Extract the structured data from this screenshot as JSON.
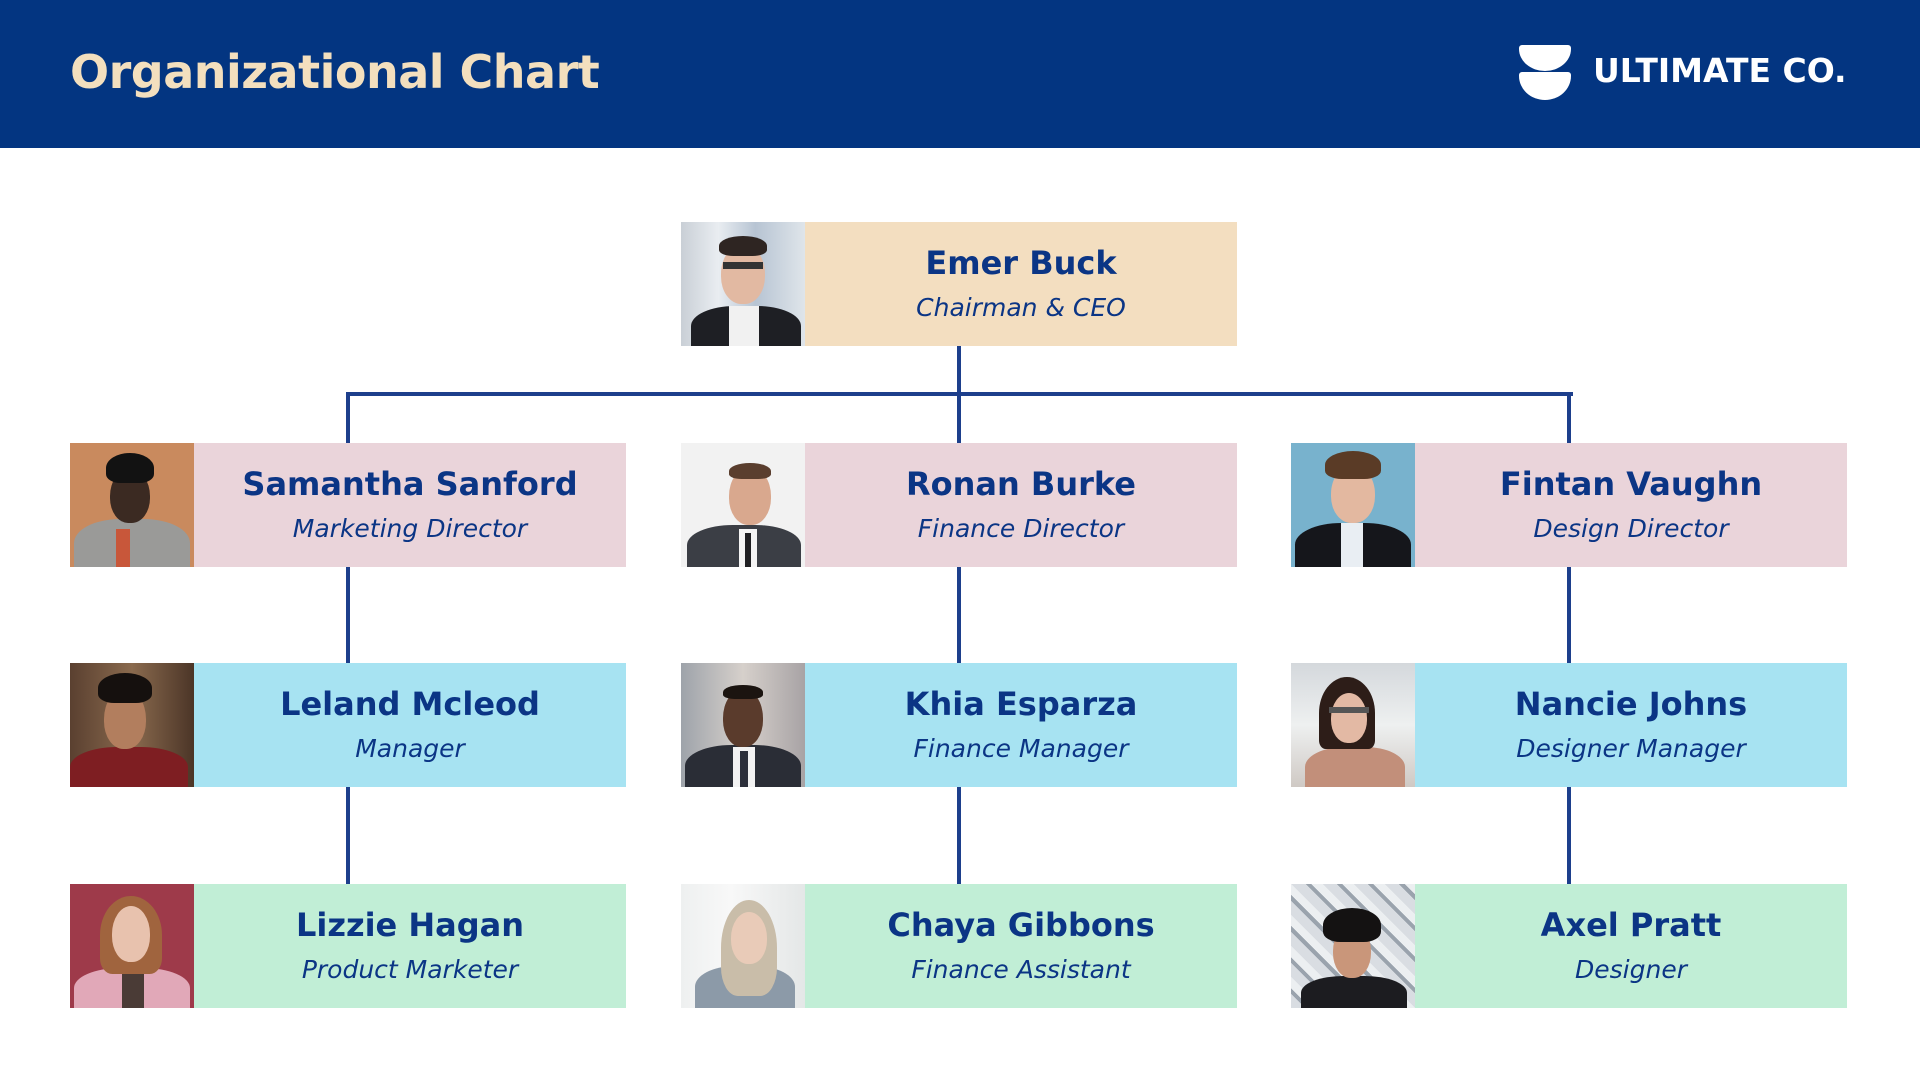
{
  "header": {
    "title": "Organizational Chart",
    "logo_icon": "stacked-bowls-logo-icon",
    "company_name": "ULTIMATE CO."
  },
  "colors": {
    "header_bg": "#033581",
    "title_text": "#F3DFBE",
    "name_text": "#0B3585",
    "connector": "#1D3F8C",
    "ceo_box": "#F3DEC0",
    "director_box": "#EAD4DA",
    "manager_box": "#A7E3F2",
    "staff_box": "#C1EED6"
  },
  "org": {
    "ceo": {
      "name": "Emer Buck",
      "role": "Chairman & CEO",
      "photo": "portrait-man-glasses-icon"
    },
    "columns": [
      {
        "director": {
          "name": "Samantha Sanford",
          "role": "Marketing Director",
          "photo": "portrait-woman-grey-blazer-icon"
        },
        "manager": {
          "name": "Leland Mcleod",
          "role": "Manager",
          "photo": "portrait-man-red-shirt-icon"
        },
        "staff": {
          "name": "Lizzie Hagan",
          "role": "Product Marketer",
          "photo": "portrait-woman-pink-blazer-icon"
        }
      },
      {
        "director": {
          "name": "Ronan Burke",
          "role": "Finance Director",
          "photo": "portrait-man-suit-smiling-icon"
        },
        "manager": {
          "name": "Khia Esparza",
          "role": "Finance Manager",
          "photo": "portrait-man-dark-suit-icon"
        },
        "staff": {
          "name": "Chaya Gibbons",
          "role": "Finance Assistant",
          "photo": "portrait-woman-blonde-icon"
        }
      },
      {
        "director": {
          "name": "Fintan Vaughn",
          "role": "Design Director",
          "photo": "portrait-man-blue-background-icon"
        },
        "manager": {
          "name": "Nancie Johns",
          "role": "Designer Manager",
          "photo": "portrait-woman-glasses-icon"
        },
        "staff": {
          "name": "Axel Pratt",
          "role": "Designer",
          "photo": "portrait-man-curly-hair-icon"
        }
      }
    ]
  }
}
